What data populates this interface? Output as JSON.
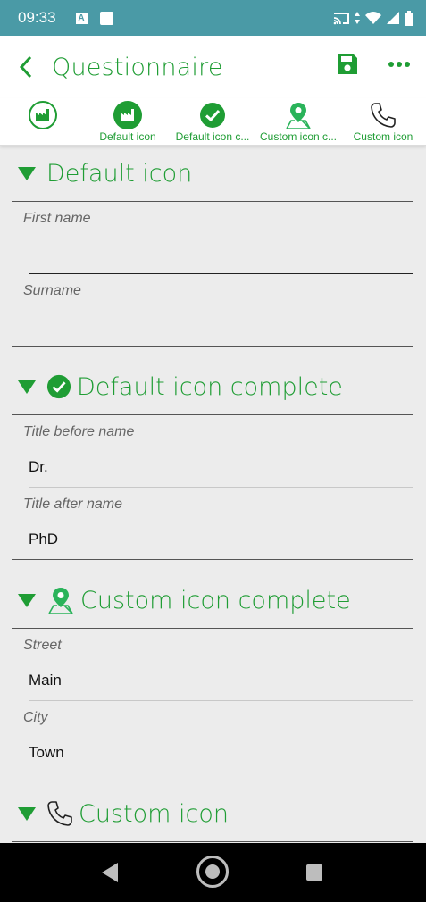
{
  "status_bar": {
    "time": "09:33",
    "a_badge": "A",
    "icons": [
      "cast-icon",
      "data-arrows-icon",
      "wifi-icon",
      "signal-icon",
      "battery-icon"
    ]
  },
  "app_bar": {
    "title": "Questionnaire",
    "back_icon": "chevron-left-icon",
    "save_icon": "save-icon",
    "more_icon": "more-horizontal-icon"
  },
  "tabs": [
    {
      "label": "",
      "icon": "factory-icon"
    },
    {
      "label": "Default icon",
      "icon": "factory-icon"
    },
    {
      "label": "Default icon c...",
      "icon": "check-circle-icon"
    },
    {
      "label": "Custom icon c...",
      "icon": "map-pin-icon"
    },
    {
      "label": "Custom icon",
      "icon": "phone-icon"
    }
  ],
  "sections": [
    {
      "title": "Default icon",
      "fields": [
        {
          "label": "First name",
          "value": ""
        },
        {
          "label": "Surname",
          "value": ""
        }
      ]
    },
    {
      "title": "Default icon complete",
      "icon": "check-circle-icon",
      "fields": [
        {
          "label": "Title before name",
          "value": "Dr."
        },
        {
          "label": "Title after name",
          "value": "PhD"
        }
      ]
    },
    {
      "title": "Custom icon complete",
      "icon": "map-pin-icon",
      "fields": [
        {
          "label": "Street",
          "value": "Main"
        },
        {
          "label": "City",
          "value": "Town"
        }
      ]
    },
    {
      "title": "Custom icon",
      "icon": "phone-icon",
      "fields": []
    }
  ],
  "colors": {
    "accent": "#1f9d34",
    "status_bar": "#4a9aa6",
    "background": "#ececec"
  }
}
